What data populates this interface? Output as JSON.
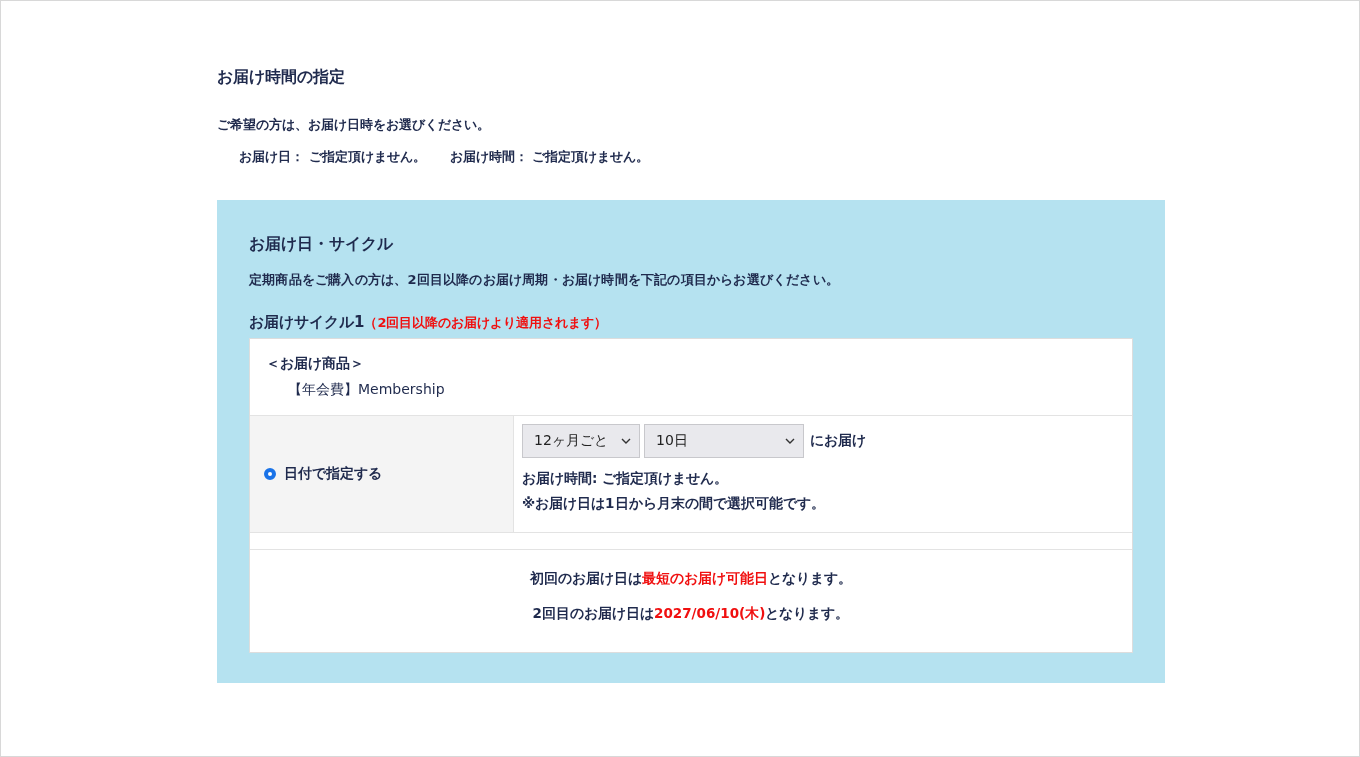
{
  "heading": "お届け時間の指定",
  "intro": "ご希望の方は、お届け日時をお選びください。",
  "summary": [
    {
      "label": "お届け日：",
      "value": "ご指定頂けません。"
    },
    {
      "label": "お届け時間：",
      "value": "ご指定頂けません。"
    }
  ],
  "cycle_panel": {
    "title": "お届け日・サイクル",
    "description": "定期商品をご購入の方は、2回目以降のお届け周期・お届け時間を下記の項目からお選びください。",
    "cycle_label": "お届けサイクル1",
    "cycle_note": "（2回目以降のお届けより適用されます）",
    "products_heading": "＜お届け商品＞",
    "product": "【年会費】Membership",
    "option": {
      "label": "日付で指定する",
      "selected": true
    },
    "interval_select": "12ヶ月ごと",
    "day_select": "10日",
    "select_suffix": "にお届け",
    "time_note": "お届け時間: ご指定頂けません。",
    "range_note": "※お届け日は1日から月末の間で選択可能です。",
    "schedule": [
      [
        {
          "text": "初回のお届け日は",
          "emphasis": false
        },
        {
          "text": "最短のお届け可能日",
          "emphasis": true
        },
        {
          "text": "となります。",
          "emphasis": false
        }
      ],
      [
        {
          "text": "2回目のお届け日は",
          "emphasis": false
        },
        {
          "text": "2027/06/10(木)",
          "emphasis": true
        },
        {
          "text": "となります。",
          "emphasis": false
        }
      ]
    ]
  }
}
